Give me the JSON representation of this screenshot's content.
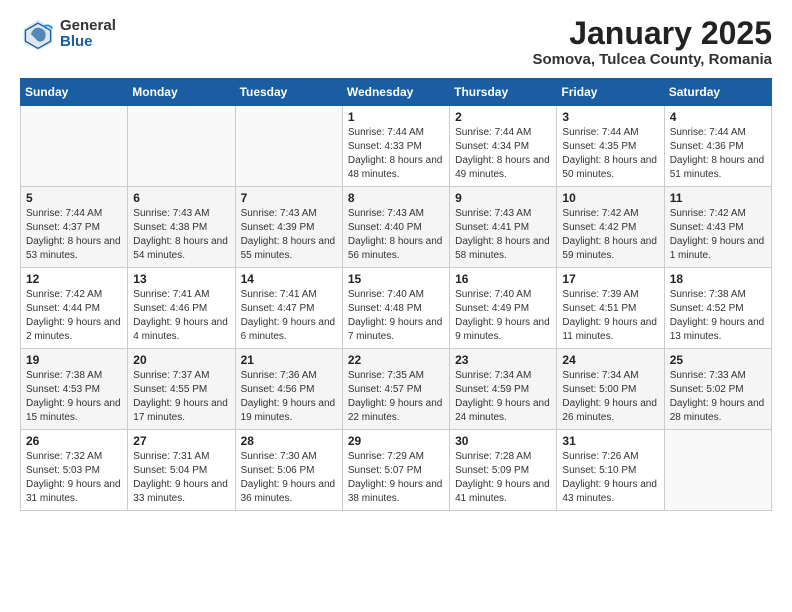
{
  "logo": {
    "general": "General",
    "blue": "Blue"
  },
  "header": {
    "title": "January 2025",
    "location": "Somova, Tulcea County, Romania"
  },
  "days_of_week": [
    "Sunday",
    "Monday",
    "Tuesday",
    "Wednesday",
    "Thursday",
    "Friday",
    "Saturday"
  ],
  "weeks": [
    [
      {
        "day": "",
        "sunrise": "",
        "sunset": "",
        "daylight": ""
      },
      {
        "day": "",
        "sunrise": "",
        "sunset": "",
        "daylight": ""
      },
      {
        "day": "",
        "sunrise": "",
        "sunset": "",
        "daylight": ""
      },
      {
        "day": "1",
        "sunrise": "Sunrise: 7:44 AM",
        "sunset": "Sunset: 4:33 PM",
        "daylight": "Daylight: 8 hours and 48 minutes."
      },
      {
        "day": "2",
        "sunrise": "Sunrise: 7:44 AM",
        "sunset": "Sunset: 4:34 PM",
        "daylight": "Daylight: 8 hours and 49 minutes."
      },
      {
        "day": "3",
        "sunrise": "Sunrise: 7:44 AM",
        "sunset": "Sunset: 4:35 PM",
        "daylight": "Daylight: 8 hours and 50 minutes."
      },
      {
        "day": "4",
        "sunrise": "Sunrise: 7:44 AM",
        "sunset": "Sunset: 4:36 PM",
        "daylight": "Daylight: 8 hours and 51 minutes."
      }
    ],
    [
      {
        "day": "5",
        "sunrise": "Sunrise: 7:44 AM",
        "sunset": "Sunset: 4:37 PM",
        "daylight": "Daylight: 8 hours and 53 minutes."
      },
      {
        "day": "6",
        "sunrise": "Sunrise: 7:43 AM",
        "sunset": "Sunset: 4:38 PM",
        "daylight": "Daylight: 8 hours and 54 minutes."
      },
      {
        "day": "7",
        "sunrise": "Sunrise: 7:43 AM",
        "sunset": "Sunset: 4:39 PM",
        "daylight": "Daylight: 8 hours and 55 minutes."
      },
      {
        "day": "8",
        "sunrise": "Sunrise: 7:43 AM",
        "sunset": "Sunset: 4:40 PM",
        "daylight": "Daylight: 8 hours and 56 minutes."
      },
      {
        "day": "9",
        "sunrise": "Sunrise: 7:43 AM",
        "sunset": "Sunset: 4:41 PM",
        "daylight": "Daylight: 8 hours and 58 minutes."
      },
      {
        "day": "10",
        "sunrise": "Sunrise: 7:42 AM",
        "sunset": "Sunset: 4:42 PM",
        "daylight": "Daylight: 8 hours and 59 minutes."
      },
      {
        "day": "11",
        "sunrise": "Sunrise: 7:42 AM",
        "sunset": "Sunset: 4:43 PM",
        "daylight": "Daylight: 9 hours and 1 minute."
      }
    ],
    [
      {
        "day": "12",
        "sunrise": "Sunrise: 7:42 AM",
        "sunset": "Sunset: 4:44 PM",
        "daylight": "Daylight: 9 hours and 2 minutes."
      },
      {
        "day": "13",
        "sunrise": "Sunrise: 7:41 AM",
        "sunset": "Sunset: 4:46 PM",
        "daylight": "Daylight: 9 hours and 4 minutes."
      },
      {
        "day": "14",
        "sunrise": "Sunrise: 7:41 AM",
        "sunset": "Sunset: 4:47 PM",
        "daylight": "Daylight: 9 hours and 6 minutes."
      },
      {
        "day": "15",
        "sunrise": "Sunrise: 7:40 AM",
        "sunset": "Sunset: 4:48 PM",
        "daylight": "Daylight: 9 hours and 7 minutes."
      },
      {
        "day": "16",
        "sunrise": "Sunrise: 7:40 AM",
        "sunset": "Sunset: 4:49 PM",
        "daylight": "Daylight: 9 hours and 9 minutes."
      },
      {
        "day": "17",
        "sunrise": "Sunrise: 7:39 AM",
        "sunset": "Sunset: 4:51 PM",
        "daylight": "Daylight: 9 hours and 11 minutes."
      },
      {
        "day": "18",
        "sunrise": "Sunrise: 7:38 AM",
        "sunset": "Sunset: 4:52 PM",
        "daylight": "Daylight: 9 hours and 13 minutes."
      }
    ],
    [
      {
        "day": "19",
        "sunrise": "Sunrise: 7:38 AM",
        "sunset": "Sunset: 4:53 PM",
        "daylight": "Daylight: 9 hours and 15 minutes."
      },
      {
        "day": "20",
        "sunrise": "Sunrise: 7:37 AM",
        "sunset": "Sunset: 4:55 PM",
        "daylight": "Daylight: 9 hours and 17 minutes."
      },
      {
        "day": "21",
        "sunrise": "Sunrise: 7:36 AM",
        "sunset": "Sunset: 4:56 PM",
        "daylight": "Daylight: 9 hours and 19 minutes."
      },
      {
        "day": "22",
        "sunrise": "Sunrise: 7:35 AM",
        "sunset": "Sunset: 4:57 PM",
        "daylight": "Daylight: 9 hours and 22 minutes."
      },
      {
        "day": "23",
        "sunrise": "Sunrise: 7:34 AM",
        "sunset": "Sunset: 4:59 PM",
        "daylight": "Daylight: 9 hours and 24 minutes."
      },
      {
        "day": "24",
        "sunrise": "Sunrise: 7:34 AM",
        "sunset": "Sunset: 5:00 PM",
        "daylight": "Daylight: 9 hours and 26 minutes."
      },
      {
        "day": "25",
        "sunrise": "Sunrise: 7:33 AM",
        "sunset": "Sunset: 5:02 PM",
        "daylight": "Daylight: 9 hours and 28 minutes."
      }
    ],
    [
      {
        "day": "26",
        "sunrise": "Sunrise: 7:32 AM",
        "sunset": "Sunset: 5:03 PM",
        "daylight": "Daylight: 9 hours and 31 minutes."
      },
      {
        "day": "27",
        "sunrise": "Sunrise: 7:31 AM",
        "sunset": "Sunset: 5:04 PM",
        "daylight": "Daylight: 9 hours and 33 minutes."
      },
      {
        "day": "28",
        "sunrise": "Sunrise: 7:30 AM",
        "sunset": "Sunset: 5:06 PM",
        "daylight": "Daylight: 9 hours and 36 minutes."
      },
      {
        "day": "29",
        "sunrise": "Sunrise: 7:29 AM",
        "sunset": "Sunset: 5:07 PM",
        "daylight": "Daylight: 9 hours and 38 minutes."
      },
      {
        "day": "30",
        "sunrise": "Sunrise: 7:28 AM",
        "sunset": "Sunset: 5:09 PM",
        "daylight": "Daylight: 9 hours and 41 minutes."
      },
      {
        "day": "31",
        "sunrise": "Sunrise: 7:26 AM",
        "sunset": "Sunset: 5:10 PM",
        "daylight": "Daylight: 9 hours and 43 minutes."
      },
      {
        "day": "",
        "sunrise": "",
        "sunset": "",
        "daylight": ""
      }
    ]
  ]
}
